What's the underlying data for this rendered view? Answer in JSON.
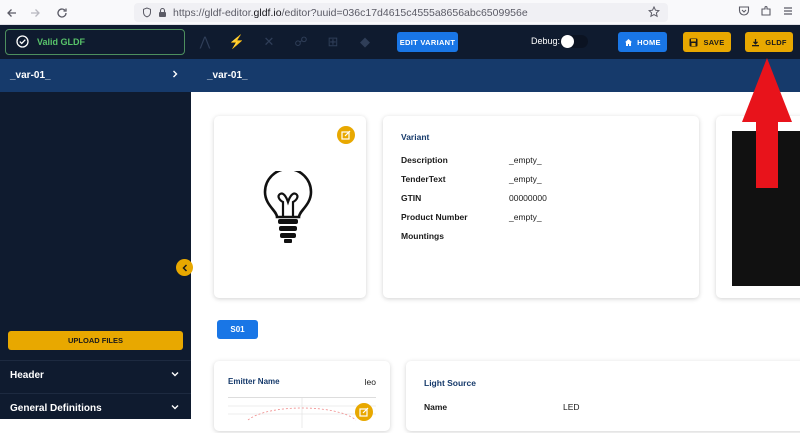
{
  "browser": {
    "url_prefix": "https://gldf-editor.",
    "url_domain": "gldf.io",
    "url_suffix": "/editor?uuid=036c17d4615c4555a8656abc6509956e"
  },
  "toolbar": {
    "valid_label": "Valid GLDF",
    "edit_variant_label": "EDIT VARIANT",
    "debug_label": "Debug:",
    "home_label": "HOME",
    "save_label": "SAVE",
    "gldf_label": "GLDF"
  },
  "sidebar": {
    "current_item": "_var-01_",
    "upload_label": "UPLOAD FILES",
    "sections": [
      "Header",
      "General Definitions"
    ]
  },
  "content": {
    "breadcrumb": "_var-01_",
    "variant": {
      "title": "Variant",
      "rows": [
        {
          "key": "Description",
          "value": "_empty_"
        },
        {
          "key": "TenderText",
          "value": "_empty_"
        },
        {
          "key": "GTIN",
          "value": "00000000"
        },
        {
          "key": "Product Number",
          "value": "_empty_"
        },
        {
          "key": "Mountings",
          "value": ""
        }
      ]
    },
    "tag": "S01",
    "emitter": {
      "label": "Emitter Name",
      "value": "leo"
    },
    "light_source": {
      "title": "Light Source",
      "name_key": "Name",
      "name_value": "LED"
    }
  },
  "colors": {
    "navy": "#0f1b2f",
    "header_blue": "#163a6b",
    "accent_blue": "#1976e6",
    "accent_yellow": "#e8a800",
    "valid_green": "#58c36a",
    "annotation_red": "#e8131b"
  },
  "icons": [
    "back-arrow-icon",
    "forward-arrow-icon",
    "reload-icon",
    "shield-icon",
    "lock-icon",
    "star-icon",
    "pocket-icon",
    "extensions-icon",
    "menu-icon",
    "check-circle-icon",
    "home-icon",
    "save-icon",
    "download-icon",
    "chevron-right-icon",
    "chevron-down-icon",
    "chevron-left-icon",
    "edit-icon",
    "light-bulb-icon",
    "red-arrow-icon"
  ]
}
